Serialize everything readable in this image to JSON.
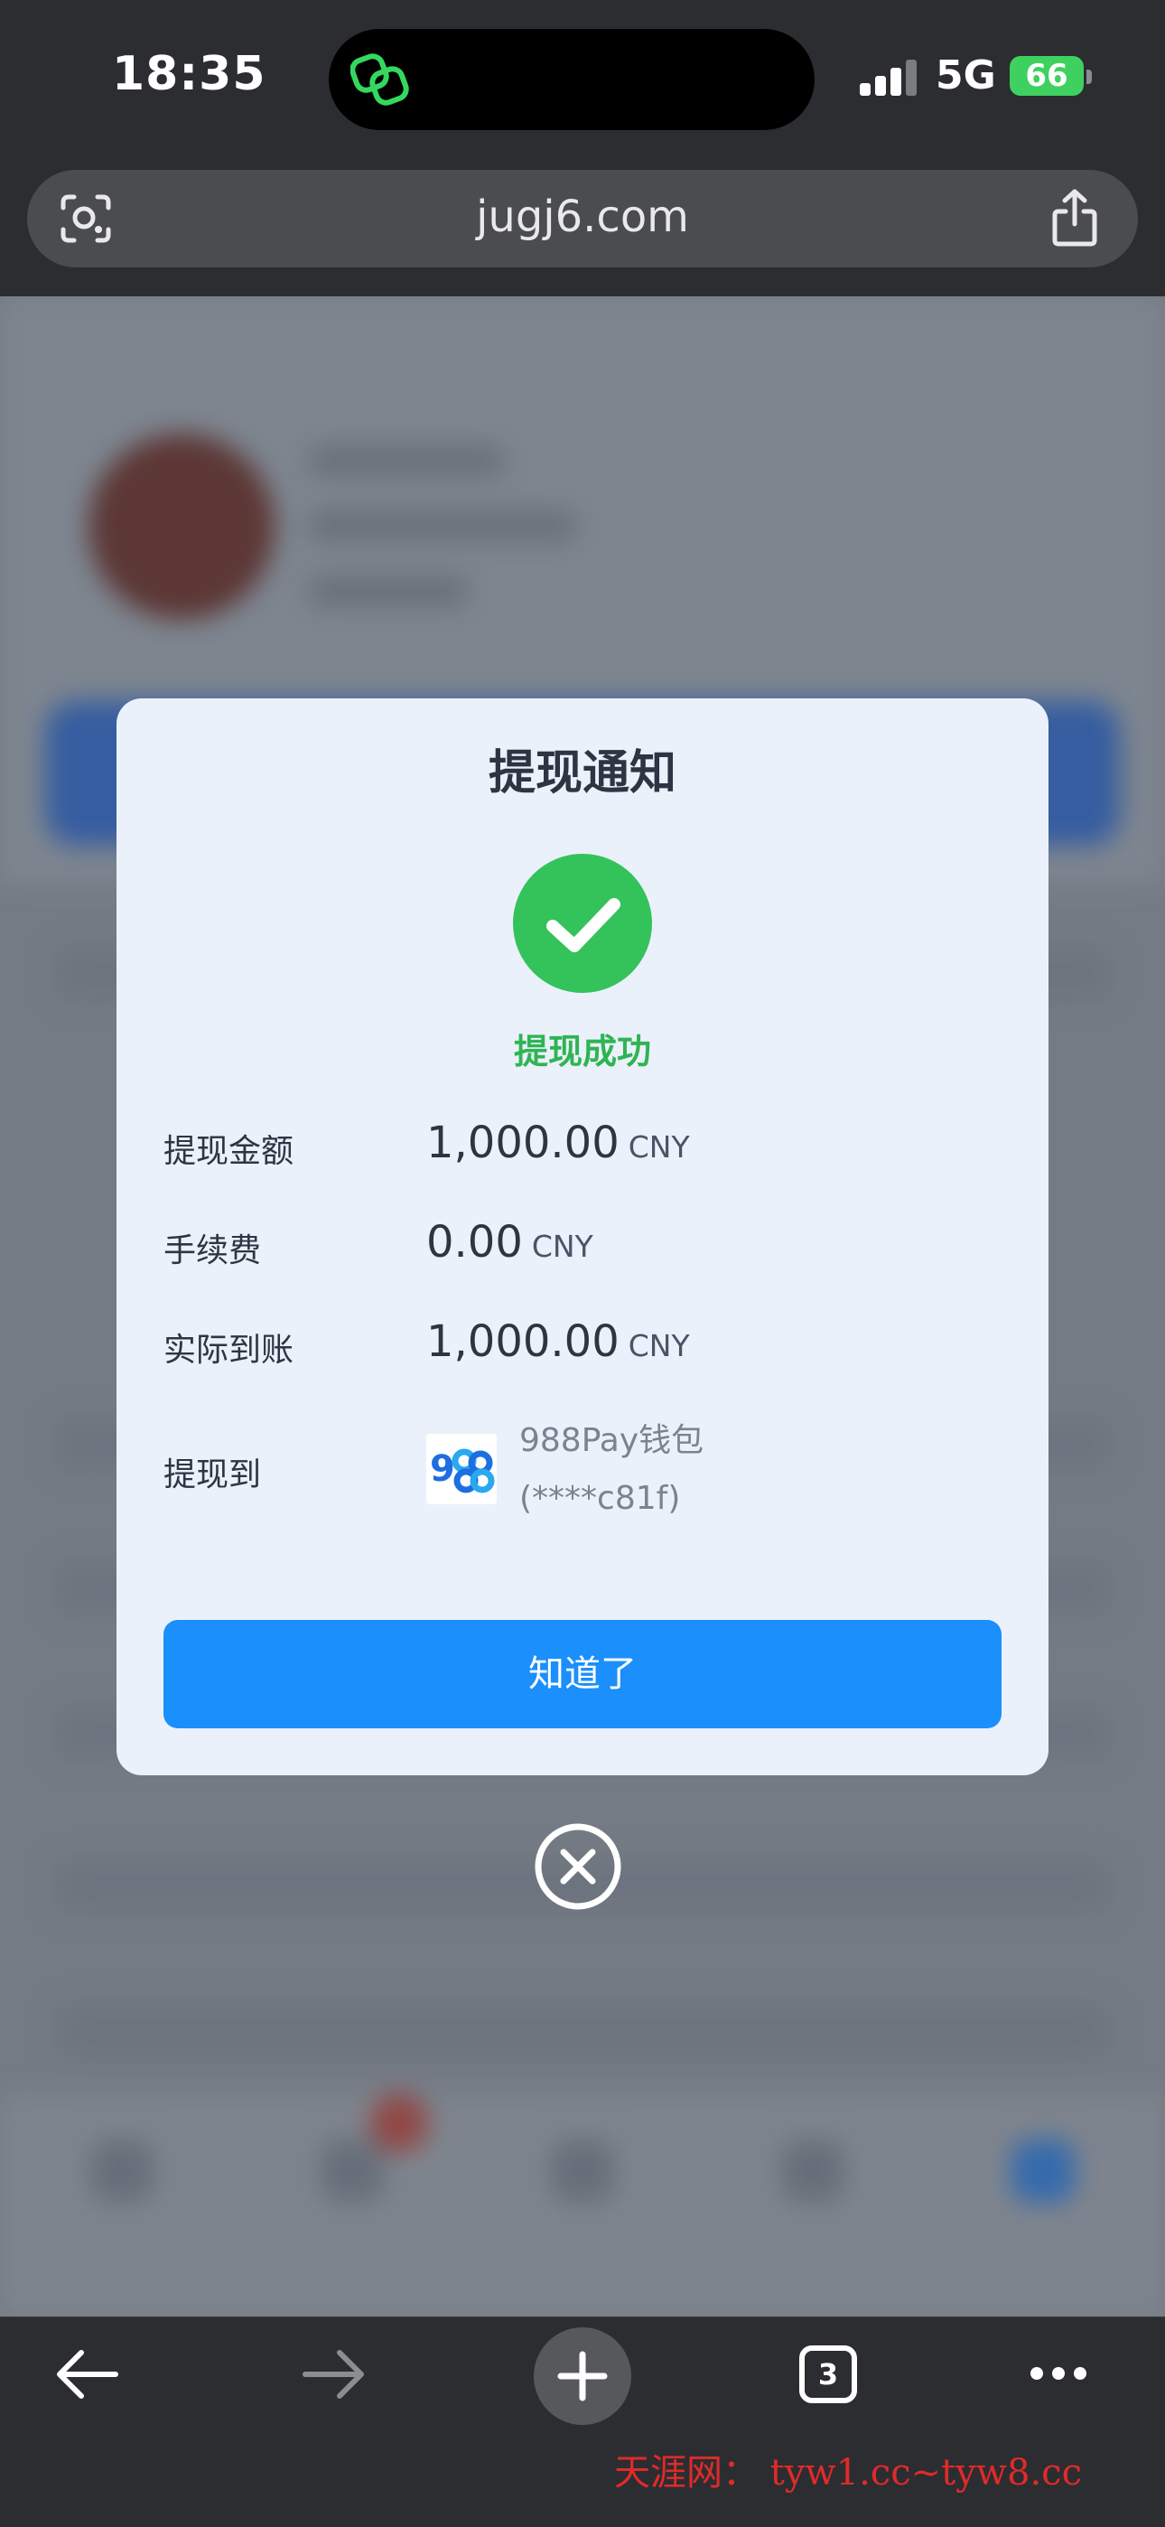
{
  "status_bar": {
    "time": "18:35",
    "network": "5G",
    "battery": "66"
  },
  "browser": {
    "url": "jugj6.com",
    "tabs_count": "3"
  },
  "modal": {
    "title": "提现通知",
    "status_text": "提现成功",
    "rows": [
      {
        "label": "提现金额",
        "value": "1,000.00",
        "unit": "CNY"
      },
      {
        "label": "手续费",
        "value": "0.00",
        "unit": "CNY"
      },
      {
        "label": "实际到账",
        "value": "1,000.00",
        "unit": "CNY"
      },
      {
        "label": "提现到",
        "wallet_name": "988Pay钱包",
        "wallet_account": "(****c81f)",
        "wallet_logo_icon": "988pay-logo-icon"
      }
    ],
    "confirm_label": "知道了"
  },
  "watermark": "天涯网： tyw1.cc~tyw8.cc",
  "colors": {
    "accent": "#1b8ffb",
    "success": "#34c25b",
    "modal_bg": "#eaf1fa"
  }
}
